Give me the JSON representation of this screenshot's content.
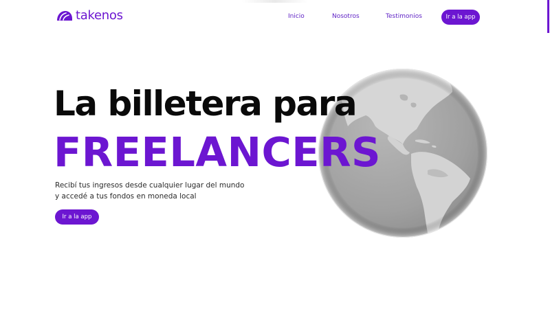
{
  "header": {
    "logo_text": "takenos",
    "logo_icon": "taco-icon",
    "nav": {
      "home": "Inicio",
      "about": "Nosotros",
      "testimonials": "Testimonios"
    },
    "cta_label": "Ir a la app"
  },
  "hero": {
    "title_line1": "La billetera para",
    "title_line2": "FREELANCERS",
    "subtitle_line1": "Recibí tus ingresos desde cualquier lugar del mundo",
    "subtitle_line2": "y accedé a tus fondos en moneda local",
    "cta_label": "Ir a la app",
    "image": "globe-americas-image"
  },
  "colors": {
    "brand": "#6c16d1",
    "title_dark": "#0a0a0a",
    "text": "#2a2a2a",
    "background": "#ffffff",
    "globe": "#9e9e9e"
  }
}
